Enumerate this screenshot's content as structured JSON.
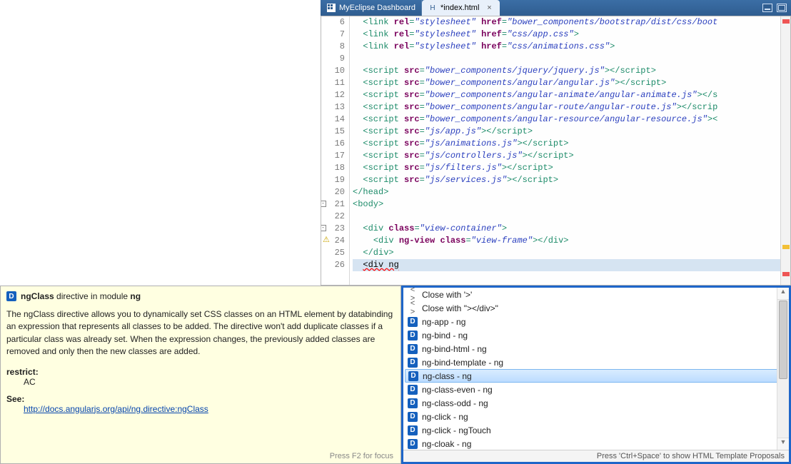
{
  "tabs": {
    "inactive": {
      "label": "MyEclipse Dashboard"
    },
    "active": {
      "label": "*index.html"
    }
  },
  "gutter_numbers": [
    "6",
    "7",
    "8",
    "9",
    "10",
    "11",
    "12",
    "13",
    "14",
    "15",
    "16",
    "17",
    "18",
    "19",
    "20",
    "21",
    "22",
    "23",
    "24",
    "25",
    "26"
  ],
  "code": {
    "lines": [
      {
        "indent": 1,
        "parts": [
          {
            "t": "tagc",
            "v": "<link "
          },
          {
            "t": "kw",
            "v": "rel"
          },
          {
            "t": "tagc",
            "v": "="
          },
          {
            "t": "str",
            "v": "\"stylesheet\""
          },
          {
            "t": "tagc",
            "v": " "
          },
          {
            "t": "kw",
            "v": "href"
          },
          {
            "t": "tagc",
            "v": "="
          },
          {
            "t": "str",
            "v": "\"bower_components/bootstrap/dist/css/boot"
          }
        ]
      },
      {
        "indent": 1,
        "parts": [
          {
            "t": "tagc",
            "v": "<link "
          },
          {
            "t": "kw",
            "v": "rel"
          },
          {
            "t": "tagc",
            "v": "="
          },
          {
            "t": "str",
            "v": "\"stylesheet\""
          },
          {
            "t": "tagc",
            "v": " "
          },
          {
            "t": "kw",
            "v": "href"
          },
          {
            "t": "tagc",
            "v": "="
          },
          {
            "t": "str",
            "v": "\"css/app.css\""
          },
          {
            "t": "tagc",
            "v": ">"
          }
        ]
      },
      {
        "indent": 1,
        "parts": [
          {
            "t": "tagc",
            "v": "<link "
          },
          {
            "t": "kw",
            "v": "rel"
          },
          {
            "t": "tagc",
            "v": "="
          },
          {
            "t": "str",
            "v": "\"stylesheet\""
          },
          {
            "t": "tagc",
            "v": " "
          },
          {
            "t": "kw",
            "v": "href"
          },
          {
            "t": "tagc",
            "v": "="
          },
          {
            "t": "str",
            "v": "\"css/animations.css\""
          },
          {
            "t": "tagc",
            "v": ">"
          }
        ]
      },
      {
        "indent": 0,
        "parts": []
      },
      {
        "indent": 1,
        "parts": [
          {
            "t": "tagc",
            "v": "<script "
          },
          {
            "t": "kw",
            "v": "src"
          },
          {
            "t": "tagc",
            "v": "="
          },
          {
            "t": "str",
            "v": "\"bower_components/jquery/jquery.js\""
          },
          {
            "t": "tagc",
            "v": ">"
          },
          {
            "t": "tagc",
            "v": "</script>"
          }
        ]
      },
      {
        "indent": 1,
        "parts": [
          {
            "t": "tagc",
            "v": "<script "
          },
          {
            "t": "kw",
            "v": "src"
          },
          {
            "t": "tagc",
            "v": "="
          },
          {
            "t": "str",
            "v": "\"bower_components/angular/angular.js\""
          },
          {
            "t": "tagc",
            "v": ">"
          },
          {
            "t": "tagc",
            "v": "</script>"
          }
        ]
      },
      {
        "indent": 1,
        "parts": [
          {
            "t": "tagc",
            "v": "<script "
          },
          {
            "t": "kw",
            "v": "src"
          },
          {
            "t": "tagc",
            "v": "="
          },
          {
            "t": "str",
            "v": "\"bower_components/angular-animate/angular-animate.js\""
          },
          {
            "t": "tagc",
            "v": ">"
          },
          {
            "t": "tagc",
            "v": "</s"
          }
        ]
      },
      {
        "indent": 1,
        "parts": [
          {
            "t": "tagc",
            "v": "<script "
          },
          {
            "t": "kw",
            "v": "src"
          },
          {
            "t": "tagc",
            "v": "="
          },
          {
            "t": "str",
            "v": "\"bower_components/angular-route/angular-route.js\""
          },
          {
            "t": "tagc",
            "v": ">"
          },
          {
            "t": "tagc",
            "v": "</scrip"
          }
        ]
      },
      {
        "indent": 1,
        "parts": [
          {
            "t": "tagc",
            "v": "<script "
          },
          {
            "t": "kw",
            "v": "src"
          },
          {
            "t": "tagc",
            "v": "="
          },
          {
            "t": "str",
            "v": "\"bower_components/angular-resource/angular-resource.js\""
          },
          {
            "t": "tagc",
            "v": ">"
          },
          {
            "t": "tagc",
            "v": "<"
          }
        ]
      },
      {
        "indent": 1,
        "parts": [
          {
            "t": "tagc",
            "v": "<script "
          },
          {
            "t": "kw",
            "v": "src"
          },
          {
            "t": "tagc",
            "v": "="
          },
          {
            "t": "str",
            "v": "\"js/app.js\""
          },
          {
            "t": "tagc",
            "v": ">"
          },
          {
            "t": "tagc",
            "v": "</script>"
          }
        ]
      },
      {
        "indent": 1,
        "parts": [
          {
            "t": "tagc",
            "v": "<script "
          },
          {
            "t": "kw",
            "v": "src"
          },
          {
            "t": "tagc",
            "v": "="
          },
          {
            "t": "str",
            "v": "\"js/animations.js\""
          },
          {
            "t": "tagc",
            "v": ">"
          },
          {
            "t": "tagc",
            "v": "</script>"
          }
        ]
      },
      {
        "indent": 1,
        "parts": [
          {
            "t": "tagc",
            "v": "<script "
          },
          {
            "t": "kw",
            "v": "src"
          },
          {
            "t": "tagc",
            "v": "="
          },
          {
            "t": "str",
            "v": "\"js/controllers.js\""
          },
          {
            "t": "tagc",
            "v": ">"
          },
          {
            "t": "tagc",
            "v": "</script>"
          }
        ]
      },
      {
        "indent": 1,
        "parts": [
          {
            "t": "tagc",
            "v": "<script "
          },
          {
            "t": "kw",
            "v": "src"
          },
          {
            "t": "tagc",
            "v": "="
          },
          {
            "t": "str",
            "v": "\"js/filters.js\""
          },
          {
            "t": "tagc",
            "v": ">"
          },
          {
            "t": "tagc",
            "v": "</script>"
          }
        ]
      },
      {
        "indent": 1,
        "parts": [
          {
            "t": "tagc",
            "v": "<script "
          },
          {
            "t": "kw",
            "v": "src"
          },
          {
            "t": "tagc",
            "v": "="
          },
          {
            "t": "str",
            "v": "\"js/services.js\""
          },
          {
            "t": "tagc",
            "v": ">"
          },
          {
            "t": "tagc",
            "v": "</script>"
          }
        ]
      },
      {
        "indent": 0,
        "parts": [
          {
            "t": "tagc",
            "v": "</head>"
          }
        ]
      },
      {
        "indent": 0,
        "fold": true,
        "parts": [
          {
            "t": "tagc",
            "v": "<body>"
          }
        ]
      },
      {
        "indent": 0,
        "parts": []
      },
      {
        "indent": 1,
        "fold": true,
        "parts": [
          {
            "t": "tagc",
            "v": "<div "
          },
          {
            "t": "kw",
            "v": "class"
          },
          {
            "t": "tagc",
            "v": "="
          },
          {
            "t": "str",
            "v": "\"view-container\""
          },
          {
            "t": "tagc",
            "v": ">"
          }
        ]
      },
      {
        "indent": 2,
        "warn": true,
        "parts": [
          {
            "t": "tagc",
            "v": "<div "
          },
          {
            "t": "kw",
            "v": "ng-view"
          },
          {
            "t": "tagc",
            "v": " "
          },
          {
            "t": "kw",
            "v": "class"
          },
          {
            "t": "tagc",
            "v": "="
          },
          {
            "t": "str",
            "v": "\"view-frame\""
          },
          {
            "t": "tagc",
            "v": ">"
          },
          {
            "t": "tagc",
            "v": "</div>"
          }
        ]
      },
      {
        "indent": 1,
        "parts": [
          {
            "t": "tagc",
            "v": "</div>"
          }
        ]
      },
      {
        "indent": 1,
        "hl": true,
        "parts": [
          {
            "t": "err",
            "v": "<div ng"
          }
        ]
      }
    ]
  },
  "doc": {
    "title_prefix": "ngClass",
    "title_mid": " directive in module ",
    "title_suffix": "ng",
    "body": "The ngClass directive allows you to dynamically set CSS classes on an HTML element by databinding an expression that represents all classes to be added. The directive won't add duplicate classes if a particular class was already set. When the expression changes, the previously added classes are removed and only then the new classes are added.",
    "restrict_label": "restrict:",
    "restrict_value": "AC",
    "see_label": "See:",
    "see_link": "http://docs.angularjs.org/api/ng.directive:ngClass",
    "footer": "Press F2 for focus"
  },
  "autocomplete": {
    "items": [
      {
        "kind": "glyph",
        "glyph": "< >",
        "label": "Close with '>'"
      },
      {
        "kind": "glyph",
        "glyph": "< >",
        "label": "Close with \"></div>\""
      },
      {
        "kind": "d",
        "label": "ng-app - ng"
      },
      {
        "kind": "d",
        "label": "ng-bind - ng"
      },
      {
        "kind": "d",
        "label": "ng-bind-html - ng"
      },
      {
        "kind": "d",
        "label": "ng-bind-template - ng"
      },
      {
        "kind": "d",
        "label": "ng-class - ng",
        "selected": true
      },
      {
        "kind": "d",
        "label": "ng-class-even - ng"
      },
      {
        "kind": "d",
        "label": "ng-class-odd - ng"
      },
      {
        "kind": "d",
        "label": "ng-click - ng"
      },
      {
        "kind": "d",
        "label": "ng-click - ngTouch"
      },
      {
        "kind": "d",
        "label": "ng-cloak - ng"
      }
    ],
    "status": "Press 'Ctrl+Space' to show HTML Template Proposals"
  }
}
